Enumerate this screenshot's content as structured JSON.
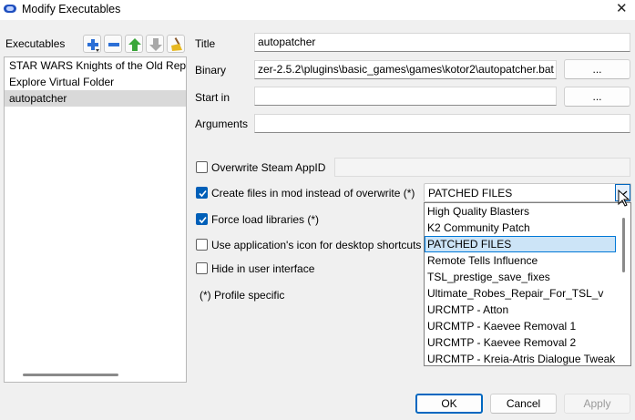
{
  "window": {
    "title": "Modify Executables",
    "close_glyph": "✕"
  },
  "sidebar": {
    "label": "Executables",
    "toolbar": {
      "add_icon": "add-icon",
      "remove_icon": "remove-icon",
      "move_up_icon": "move-up-icon",
      "move_down_icon": "move-down-icon",
      "clean_icon": "broom-icon"
    },
    "items": [
      {
        "label": "STAR WARS Knights of the Old Republic"
      },
      {
        "label": "Explore Virtual Folder"
      },
      {
        "label": "autopatcher"
      }
    ],
    "selected_index": 2
  },
  "form": {
    "title_label": "Title",
    "title_value": "autopatcher",
    "binary_label": "Binary",
    "binary_value": "zer-2.5.2\\plugins\\basic_games\\games\\kotor2\\autopatcher.bat",
    "browse_label": "...",
    "start_in_label": "Start in",
    "start_in_value": "",
    "arguments_label": "Arguments",
    "arguments_value": ""
  },
  "options": {
    "overwrite_steam_appid": {
      "label": "Overwrite Steam AppID",
      "checked": false,
      "value": ""
    },
    "create_files_in_mod": {
      "label": "Create files in mod instead of overwrite (*)",
      "checked": true
    },
    "force_load_libraries": {
      "label": "Force load libraries (*)",
      "checked": true
    },
    "use_app_icon": {
      "label": "Use application's icon for desktop shortcuts",
      "checked": false
    },
    "hide_in_ui": {
      "label": "Hide in user interface",
      "checked": false
    },
    "profile_note": "(*) Profile specific"
  },
  "mod_select": {
    "selected": "PATCHED FILES",
    "options": [
      "High Quality Blasters",
      "K2 Community Patch",
      "PATCHED FILES",
      "Remote Tells Influence",
      "TSL_prestige_save_fixes",
      "Ultimate_Robes_Repair_For_TSL_v",
      "URCMTP - Atton",
      "URCMTP - Kaevee Removal 1",
      "URCMTP - Kaevee Removal 2",
      "URCMTP - Kreia-Atris Dialogue Tweak"
    ],
    "highlighted_index": 2
  },
  "footer": {
    "ok_label": "OK",
    "cancel_label": "Cancel",
    "apply_label": "Apply"
  },
  "colors": {
    "accent": "#005fb8",
    "selection_bg": "#cce4f7",
    "list_selection": "#d9d9d9"
  }
}
